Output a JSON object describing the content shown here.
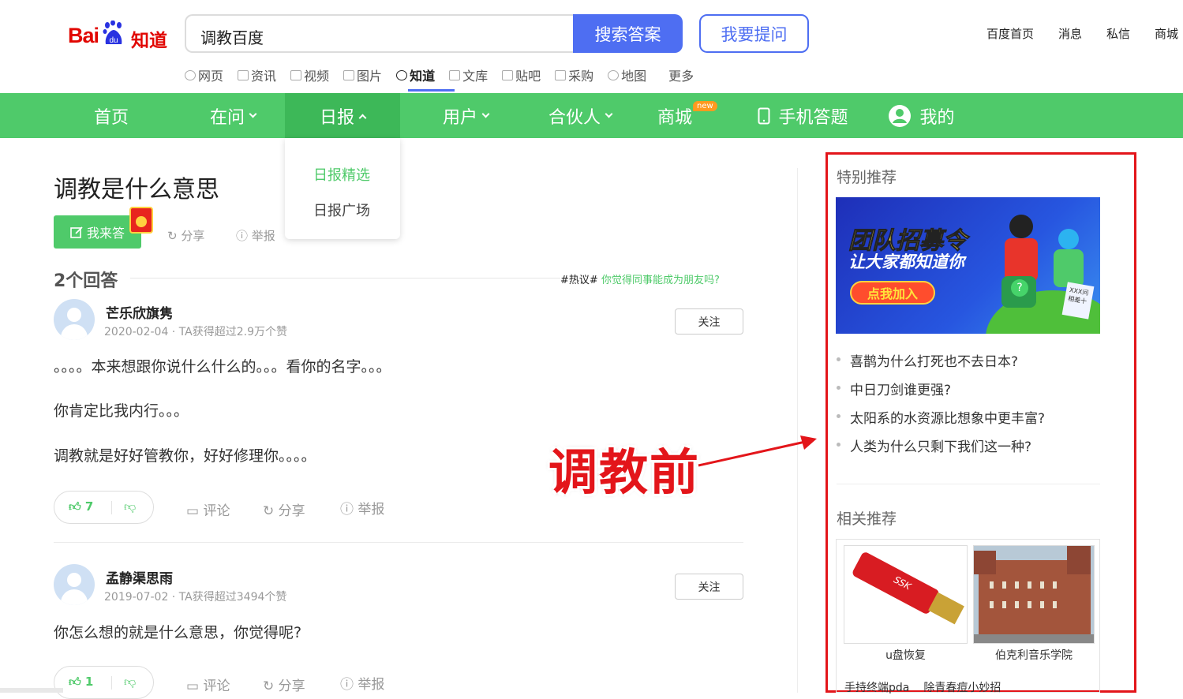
{
  "header": {
    "logo": {
      "bai": "Bai",
      "du": "du",
      "zhidao": "知道"
    },
    "search_value": "调教百度",
    "search_button": "搜索答案",
    "ask_button": "我要提问",
    "top_links": [
      "百度首页",
      "消息",
      "私信",
      "商城"
    ]
  },
  "subnav": [
    {
      "label": "网页",
      "icon": "search-icon"
    },
    {
      "label": "资讯",
      "icon": "news-icon"
    },
    {
      "label": "视频",
      "icon": "video-icon"
    },
    {
      "label": "图片",
      "icon": "image-icon"
    },
    {
      "label": "知道",
      "icon": "question-icon",
      "active": true
    },
    {
      "label": "文库",
      "icon": "doc-icon"
    },
    {
      "label": "贴吧",
      "icon": "tieba-icon"
    },
    {
      "label": "采购",
      "icon": "shop-icon"
    },
    {
      "label": "地图",
      "icon": "map-icon"
    },
    {
      "label": "更多"
    }
  ],
  "greennav": {
    "items": [
      "首页",
      "在问",
      "日报",
      "用户",
      "合伙人",
      "商城",
      "手机答题",
      "我的"
    ],
    "new_badge": "new",
    "dropdown": [
      "日报精选",
      "日报广场"
    ],
    "colors": {
      "nav": "#4fca6a",
      "active": "#3db858"
    }
  },
  "question": {
    "title": "调教是什么意思",
    "answer_button": "我来答",
    "share": "分享",
    "report": "举报"
  },
  "answers_header": {
    "count": "2个回答",
    "hot_tag": "#热议#",
    "hot_link": "你觉得同事能成为朋友吗?"
  },
  "answers": [
    {
      "user": "芒乐欣旗隽",
      "meta": "2020-02-04 · TA获得超过2.9万个赞",
      "follow": "关注",
      "paragraphs": [
        "。。。。本来想跟你说什么什么的。。。看你的名字。。。",
        "你肯定比我内行。。。",
        "调教就是好好管教你，好好修理你。。。。"
      ],
      "likes": "7",
      "comment": "评论",
      "share": "分享",
      "report": "举报"
    },
    {
      "user": "孟静渠思雨",
      "meta": "2019-07-02 · TA获得超过3494个赞",
      "follow": "关注",
      "paragraphs": [
        "你怎么想的就是什么意思，你觉得呢?"
      ],
      "likes": "1",
      "comment": "评论",
      "share": "分享",
      "report": "举报"
    }
  ],
  "annotation": {
    "text": "调教前",
    "color": "#e3151a"
  },
  "sidebar": {
    "special_title": "特别推荐",
    "banner": {
      "line1": "团队招募令",
      "line2": "让大家都知道你",
      "cta": "点我加入",
      "doc": "XXX问 相差十"
    },
    "list": [
      "喜鹊为什么打死也不去日本?",
      "中日刀剑谁更强?",
      "太阳系的水资源比想象中更丰富?",
      "人类为什么只剩下我们这一种?"
    ],
    "related_title": "相关推荐",
    "related": [
      {
        "caption": "u盘恢复",
        "brand": "SSK"
      },
      {
        "caption": "伯克利音乐学院"
      }
    ],
    "bottom_links": [
      "手持终端pda",
      "除青春痘小妙招"
    ]
  }
}
